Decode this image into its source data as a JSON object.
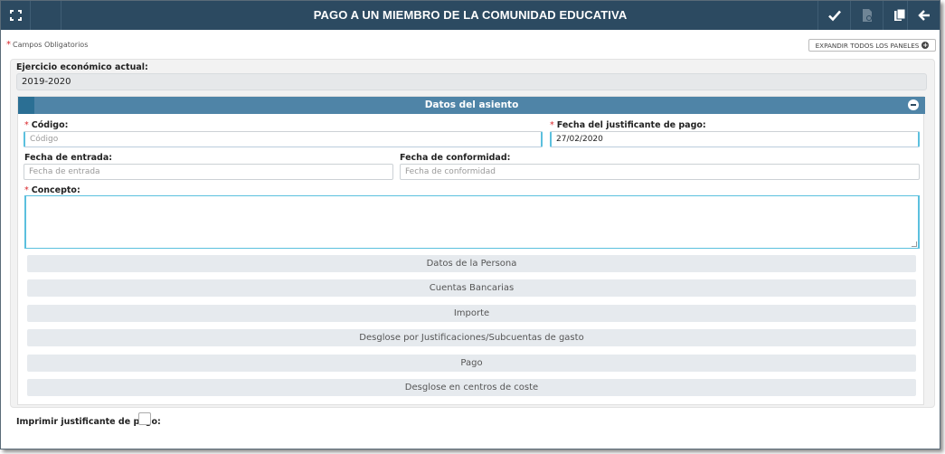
{
  "header": {
    "title": "PAGO A UN MIEMBRO DE LA COMUNIDAD EDUCATIVA",
    "icons": [
      "fullscreen-icon",
      "check-icon",
      "document-icon",
      "copy-icon",
      "arrow-left-icon"
    ]
  },
  "required_note": "Campos Obligatorios",
  "expand_all_label": "EXPANDIR TODOS LOS PANELES",
  "fiscal_year": {
    "label": "Ejercicio económico actual:",
    "value": "2019-2020"
  },
  "panel": {
    "title": "Datos del asiento",
    "codigo": {
      "label": "Código:",
      "placeholder": "Código",
      "value": ""
    },
    "fecha_justificante": {
      "label": "Fecha del justificante de pago:",
      "value": "27/02/2020"
    },
    "fecha_entrada": {
      "label": "Fecha de entrada:",
      "placeholder": "Fecha de entrada"
    },
    "fecha_conformidad": {
      "label": "Fecha de conformidad:",
      "placeholder": "Fecha de conformidad"
    },
    "concepto": {
      "label": "Concepto:",
      "value": ""
    },
    "sections": [
      "Datos de la Persona",
      "Cuentas Bancarias",
      "Importe",
      "Desglose por Justificaciones/Subcuentas de gasto",
      "Pago",
      "Desglose en centros de coste"
    ]
  },
  "print_receipt": {
    "label": "Imprimir justificante de pago:",
    "checked": false
  },
  "colors": {
    "header_bg": "#2c4a61",
    "panel_header_bg": "#4f84a7",
    "required_star": "#d9262b",
    "focus_border": "#5bc0de"
  }
}
